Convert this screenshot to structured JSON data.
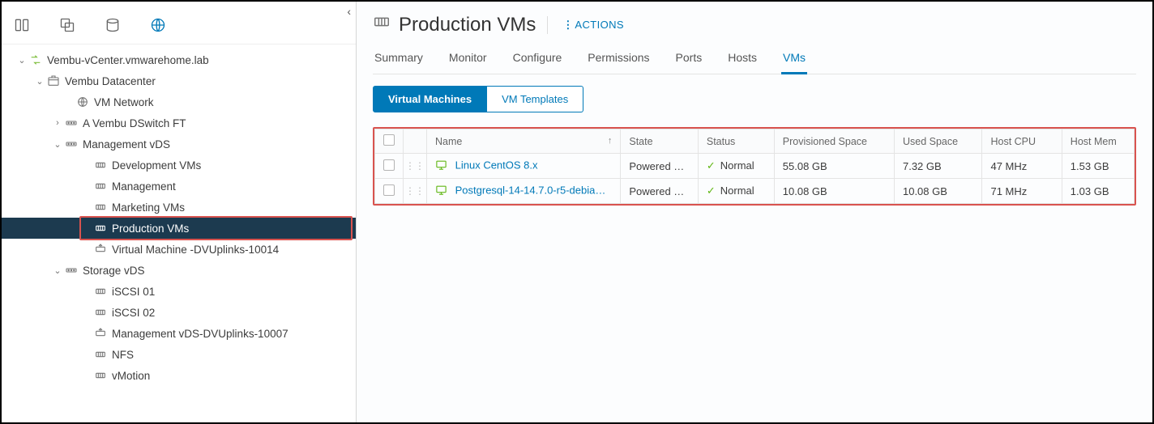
{
  "sidebar": {
    "collapse_glyph": "‹",
    "root": {
      "label": "Vembu-vCenter.vmwarehome.lab",
      "children": [
        {
          "label": "Vembu Datacenter",
          "children": [
            {
              "label": "VM Network"
            },
            {
              "label": "A Vembu DSwitch FT",
              "expandable": true,
              "expanded": false
            },
            {
              "label": "Management vDS",
              "expandable": true,
              "expanded": true,
              "children": [
                {
                  "label": "Development VMs"
                },
                {
                  "label": "Management"
                },
                {
                  "label": "Marketing VMs"
                },
                {
                  "label": "Production VMs",
                  "selected": true
                },
                {
                  "label": "Virtual Machine -DVUplinks-10014"
                }
              ]
            },
            {
              "label": "Storage vDS",
              "expandable": true,
              "expanded": true,
              "children": [
                {
                  "label": "iSCSI 01"
                },
                {
                  "label": "iSCSI 02"
                },
                {
                  "label": "Management vDS-DVUplinks-10007"
                },
                {
                  "label": "NFS"
                },
                {
                  "label": "vMotion"
                }
              ]
            }
          ]
        }
      ]
    }
  },
  "page": {
    "title": "Production VMs",
    "actions_label": "ACTIONS",
    "tabs": [
      "Summary",
      "Monitor",
      "Configure",
      "Permissions",
      "Ports",
      "Hosts",
      "VMs"
    ],
    "active_tab": "VMs",
    "subtabs": [
      "Virtual Machines",
      "VM Templates"
    ],
    "active_subtab": "Virtual Machines"
  },
  "table": {
    "columns": [
      "Name",
      "State",
      "Status",
      "Provisioned Space",
      "Used Space",
      "Host CPU",
      "Host Mem"
    ],
    "sort_column": "Name",
    "sort_dir": "asc",
    "rows": [
      {
        "name": "Linux CentOS 8.x",
        "state": "Powered …",
        "status": "Normal",
        "provisioned": "55.08 GB",
        "used": "7.32 GB",
        "cpu": "47 MHz",
        "mem": "1.53 GB"
      },
      {
        "name": "Postgresql-14-14.7.0-r5-debia…",
        "state": "Powered …",
        "status": "Normal",
        "provisioned": "10.08 GB",
        "used": "10.08 GB",
        "cpu": "71 MHz",
        "mem": "1.03 GB"
      }
    ]
  }
}
